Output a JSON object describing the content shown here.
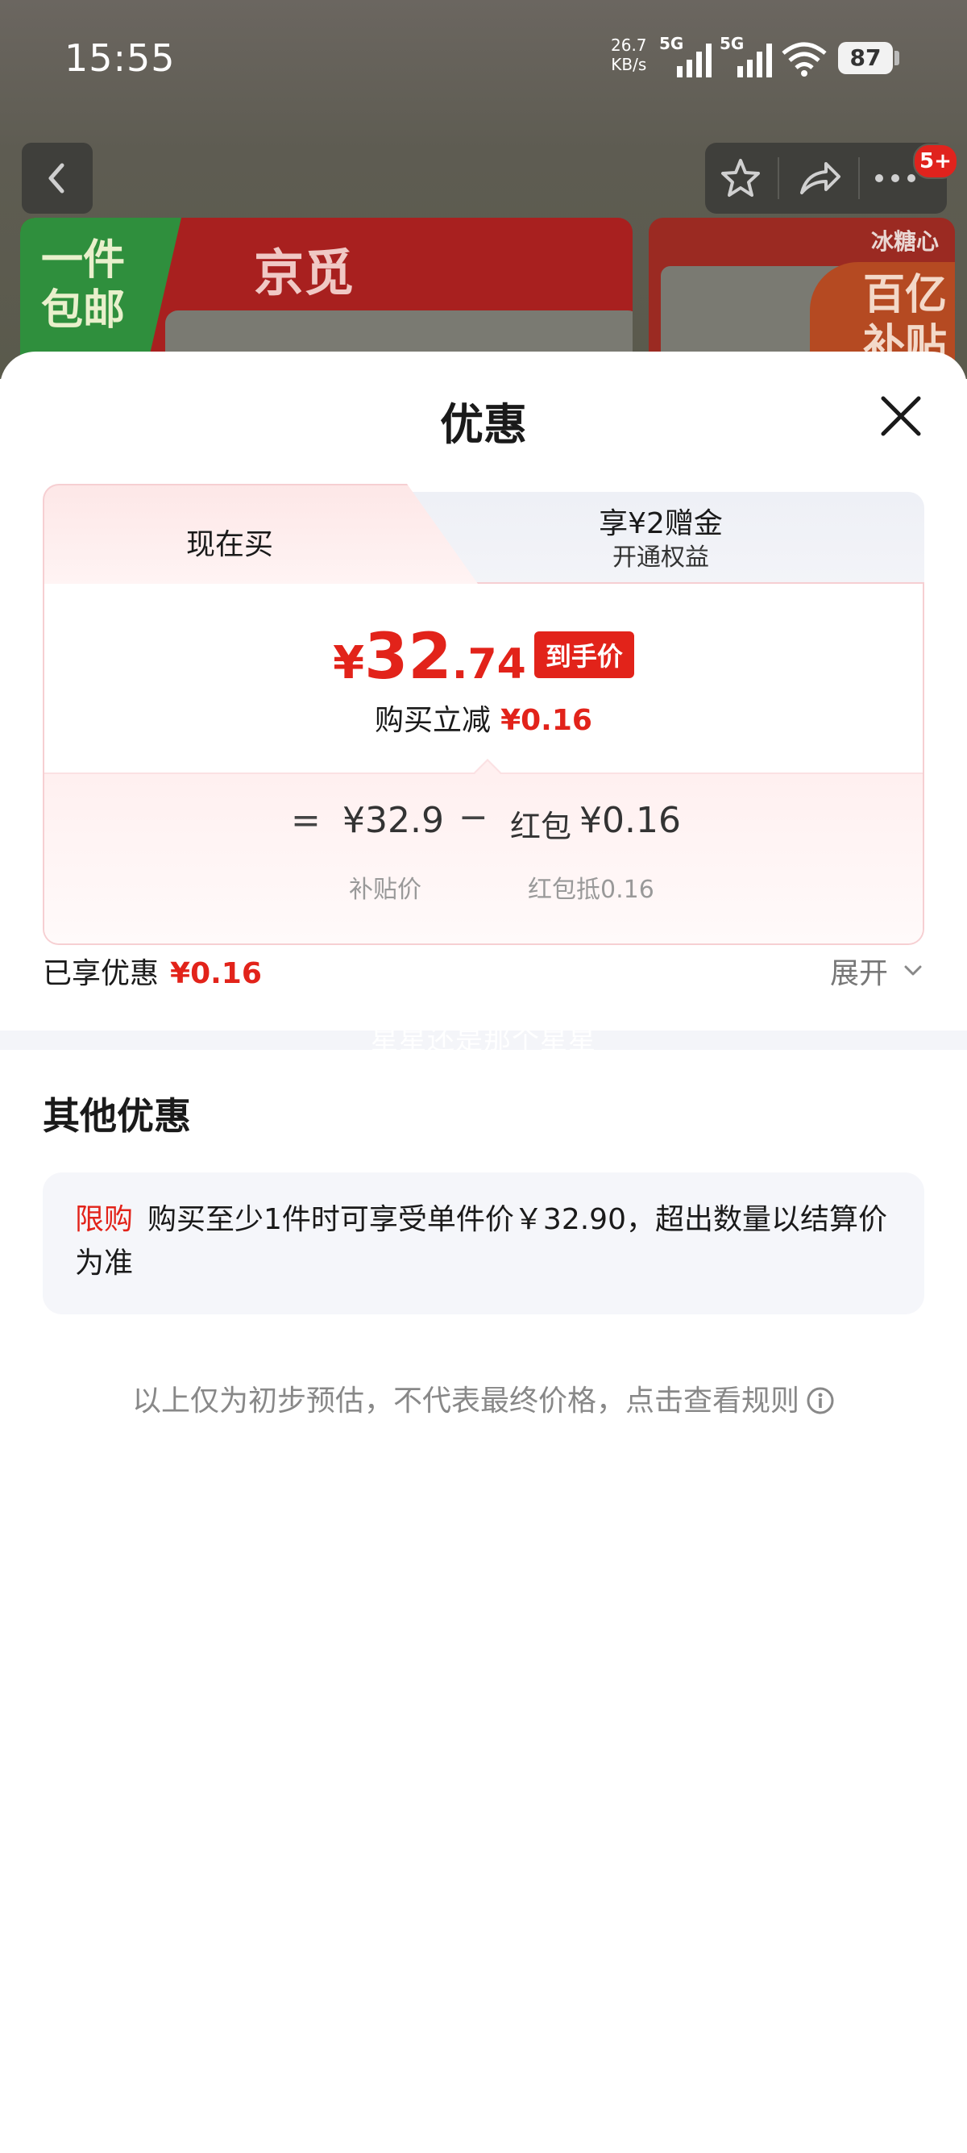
{
  "status_bar": {
    "time": "15:55",
    "net_speed_value": "26.7",
    "net_speed_unit": "KB/s",
    "sim1": "5G",
    "sim2": "5G",
    "battery": "87"
  },
  "background_app": {
    "badge": "5+",
    "banner_left_tag_line1": "一件",
    "banner_left_tag_line2": "包邮",
    "banner_left_brand": "京觅",
    "banner_right_tag": "冰糖心",
    "banner_right_sub_line1": "百亿",
    "banner_right_sub_line2": "补贴"
  },
  "sheet": {
    "title": "优惠",
    "tabs": [
      {
        "label": "现在买"
      },
      {
        "label_line1": "享¥2赠金",
        "label_line2": "开通权益"
      }
    ],
    "price": {
      "currency": "¥",
      "integer": "32",
      "decimal": ".74",
      "tag": "到手价"
    },
    "reduce_label": "购买立减",
    "reduce_value": "¥0.16",
    "formula": {
      "equals": "=",
      "subsidy_value": "¥32.9",
      "minus": "−",
      "hongbao_label": "红包",
      "hongbao_value": "¥0.16",
      "subsidy_caption": "补贴价",
      "hongbao_caption": "红包抵0.16"
    },
    "enjoyed_label": "已享优惠",
    "enjoyed_value": "¥0.16",
    "expand_label": "展开",
    "watermark": "星星还是那个星星",
    "other_title": "其他优惠",
    "limit_tag": "限购",
    "limit_text": "购买至少1件时可享受单件价￥32.90，超出数量以结算价为准",
    "disclaimer": "以上仅为初步预估，不代表最终价格，点击查看规则"
  },
  "colors": {
    "accent_red": "#e2231a",
    "tab_border": "#f6cfd2",
    "divider": "#f4f5f9"
  }
}
